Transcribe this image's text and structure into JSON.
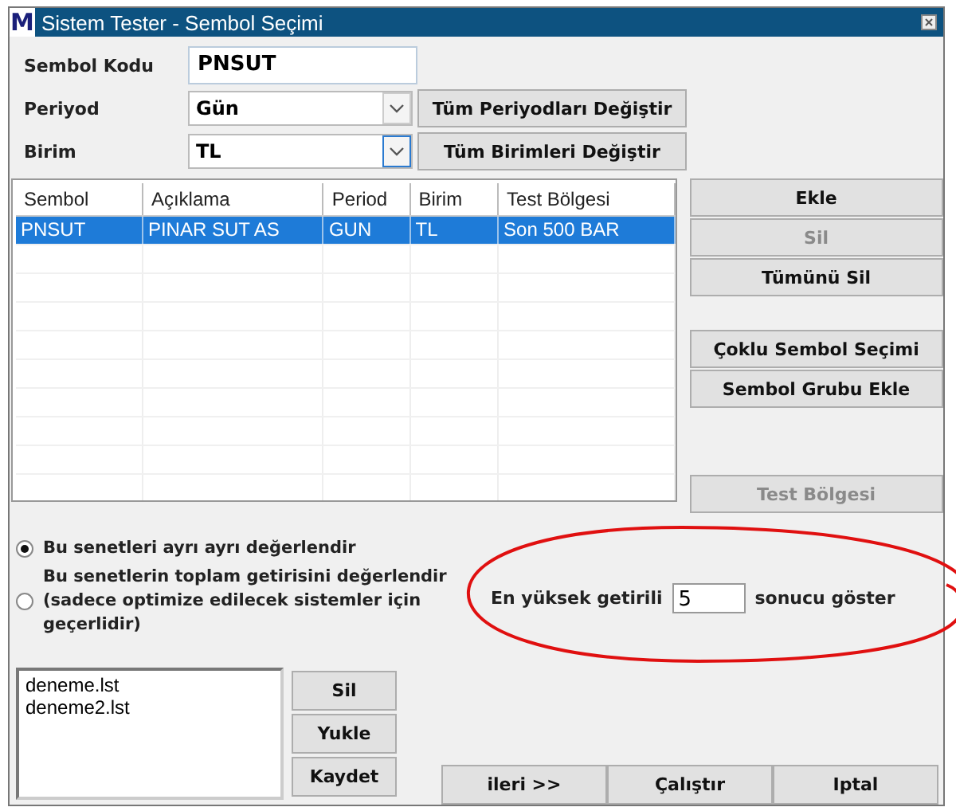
{
  "window": {
    "title": "Sistem Tester - Sembol Seçimi",
    "logo": "M"
  },
  "form": {
    "symbol_label": "Sembol Kodu",
    "symbol_value": "PNSUT",
    "period_label": "Periyod",
    "period_value": "Gün",
    "period_button": "Tüm Periyodları Değiştir",
    "unit_label": "Birim",
    "unit_value": "TL",
    "unit_button": "Tüm Birimleri Değiştir"
  },
  "table": {
    "columns": [
      "Sembol",
      "Açıklama",
      "Period",
      "Birim",
      "Test Bölgesi"
    ],
    "rows": [
      {
        "cells": [
          "PNSUT",
          "PINAR SUT AS",
          "GUN",
          "TL",
          "Son 500 BAR"
        ],
        "selected": true
      }
    ]
  },
  "side_button_groups": [
    [
      {
        "label": "Ekle",
        "disabled": false
      },
      {
        "label": "Sil",
        "disabled": true
      },
      {
        "label": "Tümünü Sil",
        "disabled": false
      }
    ],
    [
      {
        "label": "Çoklu Sembol Seçimi",
        "disabled": false
      },
      {
        "label": "Sembol Grubu Ekle",
        "disabled": false
      }
    ],
    [
      {
        "label": "Test Bölgesi",
        "disabled": true
      }
    ]
  ],
  "mode_options": [
    {
      "label": "Bu senetleri ayrı ayrı değerlendir",
      "selected": true
    },
    {
      "label": "Bu senetlerin toplam getirisini değerlendir (sadece optimize edilecek sistemler için geçerlidir)",
      "selected": false
    }
  ],
  "top_results": {
    "label": "En yüksek getirili",
    "value": "5",
    "suffix": "sonucu göster"
  },
  "lists": {
    "items": [
      "deneme.lst",
      "deneme2.lst"
    ],
    "buttons": [
      "Sil",
      "Yukle",
      "Kaydet"
    ]
  },
  "footer_buttons": [
    "ileri >>",
    "Çalıştır",
    "Iptal"
  ]
}
